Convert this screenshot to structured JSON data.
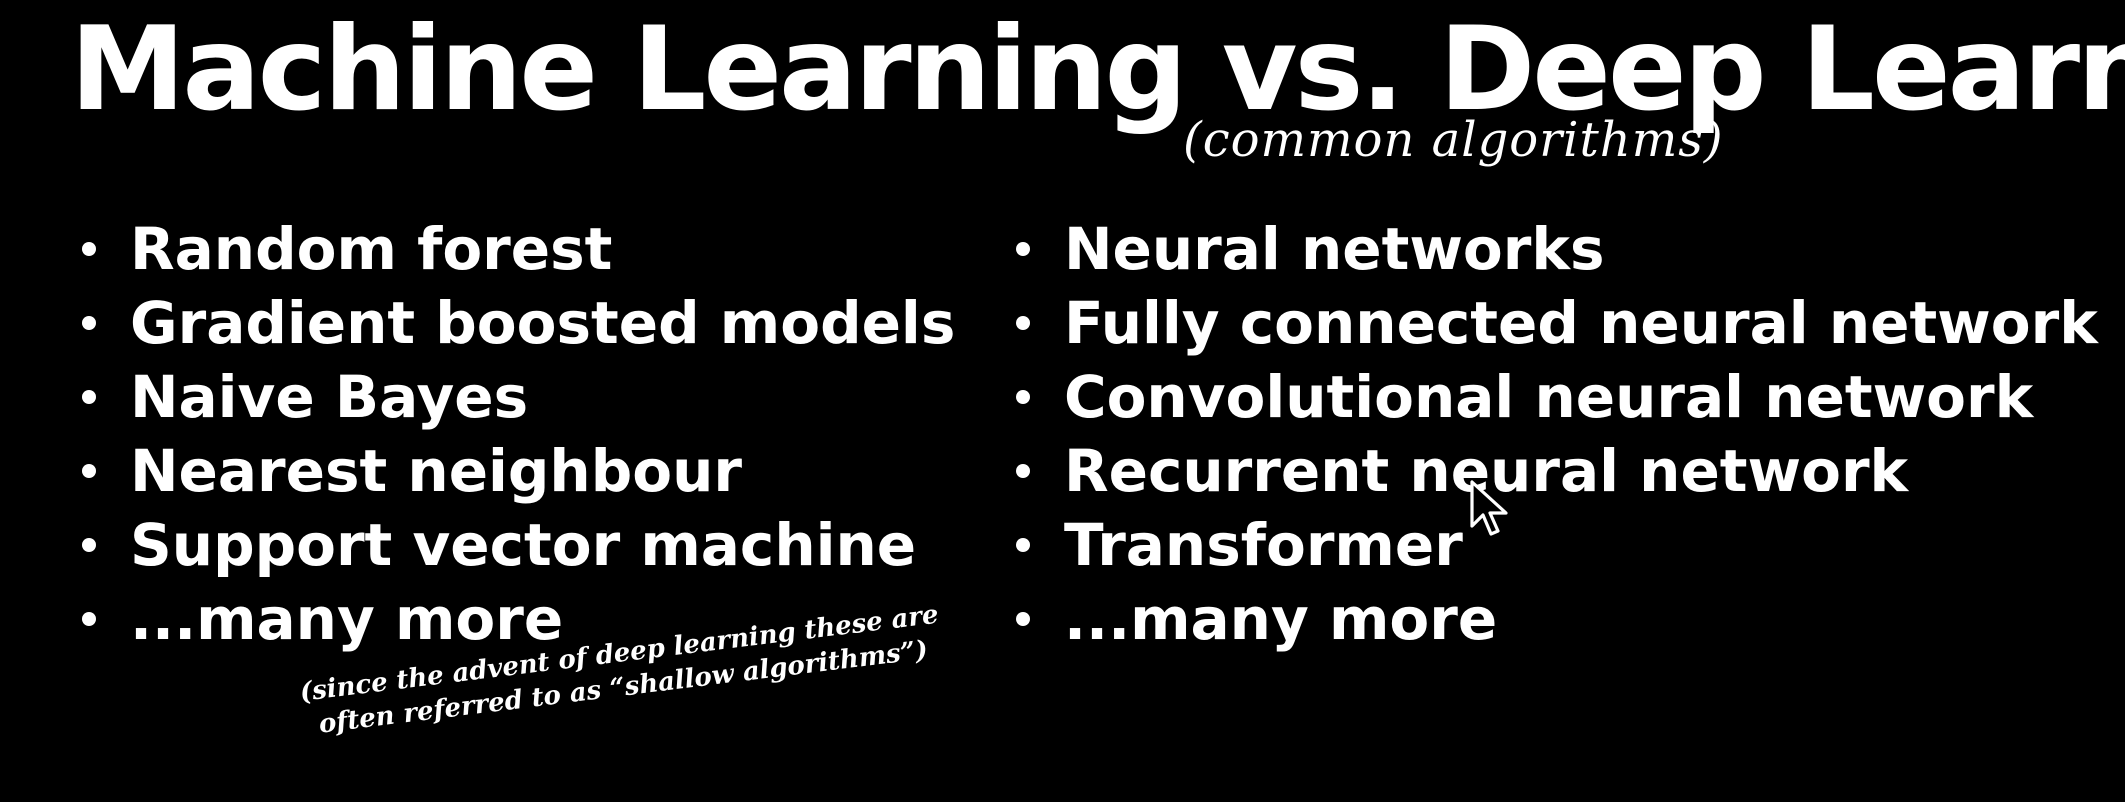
{
  "slide": {
    "title": "Machine Learning vs. Deep Learning",
    "subtitle": "(common algorithms)",
    "machine_learning": {
      "items": [
        "Random forest",
        "Gradient boosted models",
        "Naive Bayes",
        "Nearest neighbour",
        "Support vector machine",
        "...many more"
      ],
      "note_line1": "(since the advent of deep learning these are",
      "note_line2": "often referred to as “shallow algorithms”)"
    },
    "deep_learning": {
      "items": [
        "Neural networks",
        "Fully connected neural network",
        "Convolutional neural network",
        "Recurrent neural network",
        "Transformer",
        "...many more"
      ]
    }
  },
  "theme": {
    "background": "#000000",
    "text": "#ffffff"
  },
  "icons": {
    "cursor": "mouse-pointer-icon"
  }
}
